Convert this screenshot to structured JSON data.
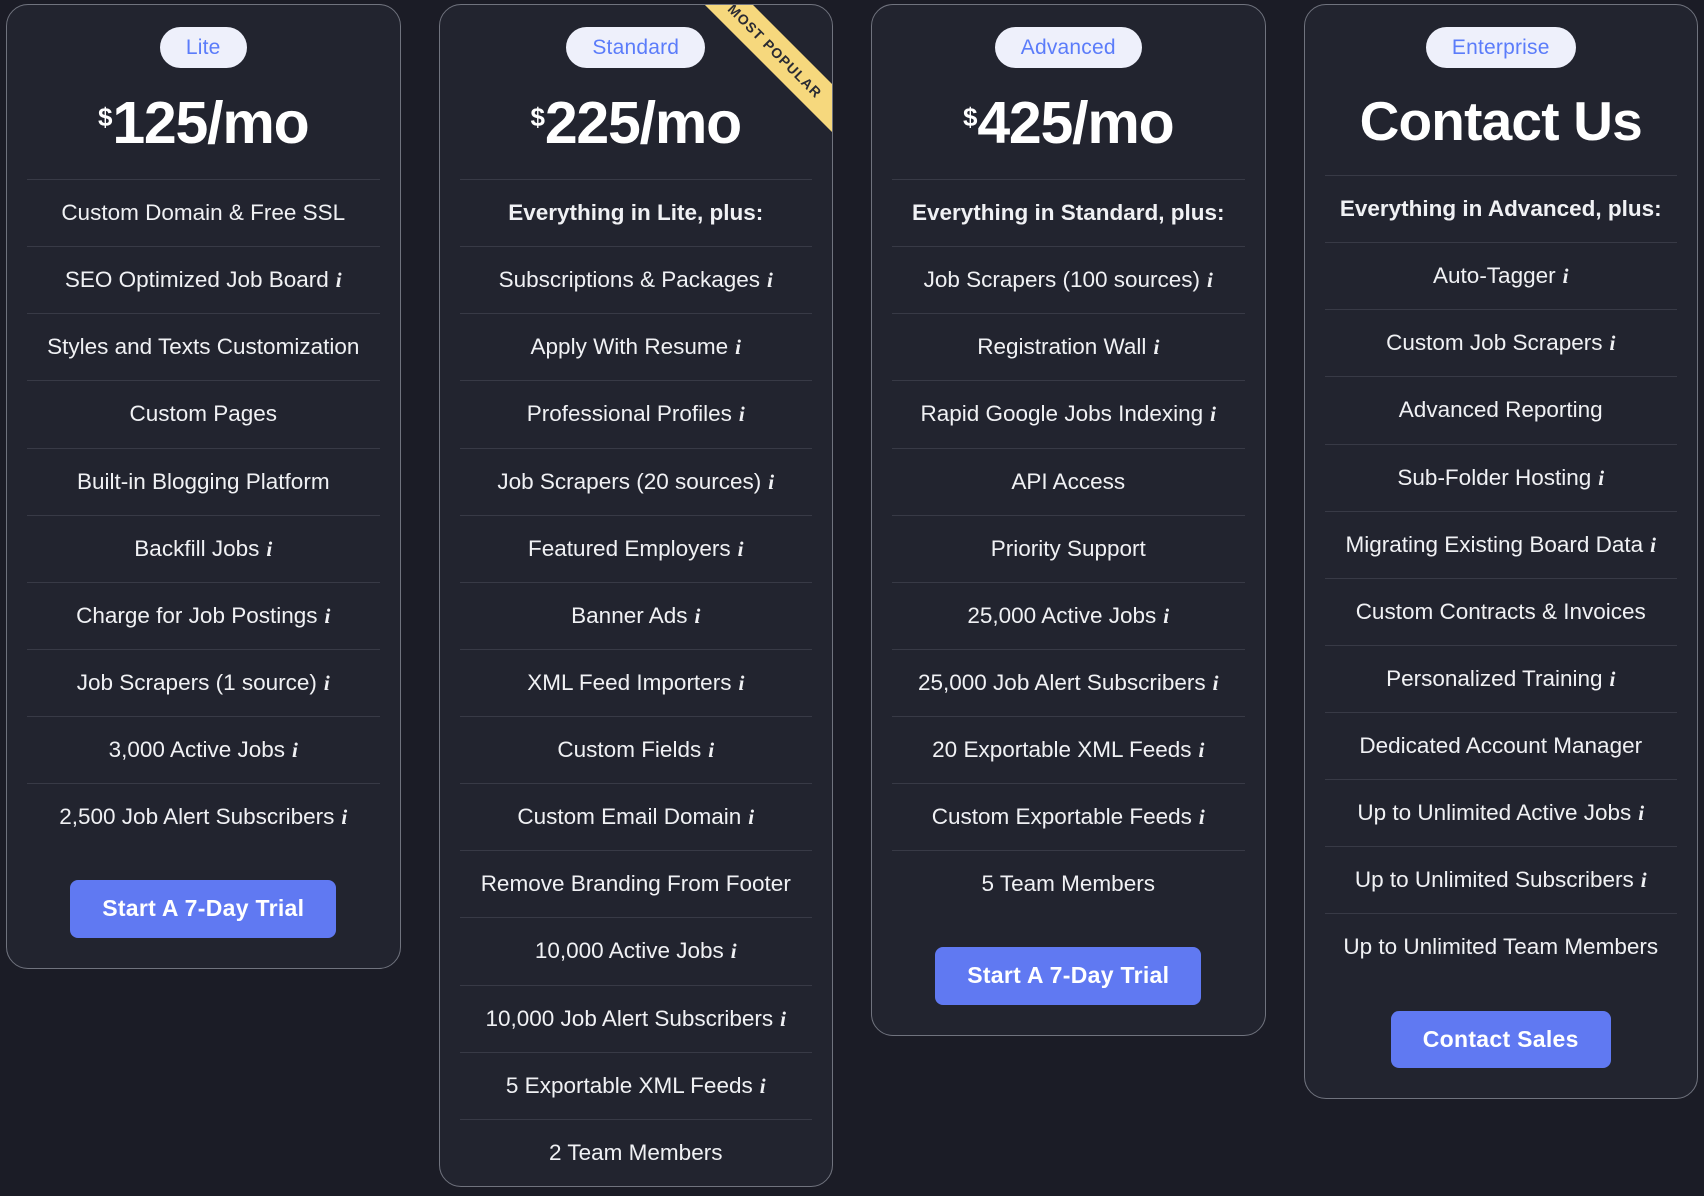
{
  "theme": {
    "page_bg": "#1b1c26",
    "card_bg": "#22242f",
    "card_border": "#70737e",
    "divider": "#383a46",
    "badge_bg": "#eef0fb",
    "badge_text": "#5b7cfa",
    "cta_bg": "#6079f2",
    "cta_text": "#ffffff",
    "ribbon_bg": "#f6d87d",
    "feature_text": "#f0f1f4"
  },
  "icons": {
    "info": "i"
  },
  "plans": [
    {
      "badge": "Lite",
      "currency": "$",
      "price": "125/mo",
      "price_is_text": false,
      "ribbon": null,
      "cta": "Start A 7-Day Trial",
      "features": [
        {
          "label": "Custom Domain & Free SSL",
          "info": false,
          "heading": false
        },
        {
          "label": "SEO Optimized Job Board",
          "info": true,
          "heading": false
        },
        {
          "label": "Styles and Texts Customization",
          "info": false,
          "heading": false
        },
        {
          "label": "Custom Pages",
          "info": false,
          "heading": false
        },
        {
          "label": "Built-in Blogging Platform",
          "info": false,
          "heading": false
        },
        {
          "label": "Backfill Jobs",
          "info": true,
          "heading": false
        },
        {
          "label": "Charge for Job Postings",
          "info": true,
          "heading": false
        },
        {
          "label": "Job Scrapers (1 source)",
          "info": true,
          "heading": false
        },
        {
          "label": "3,000 Active Jobs",
          "info": true,
          "heading": false
        },
        {
          "label": "2,500 Job Alert Subscribers",
          "info": true,
          "heading": false
        }
      ]
    },
    {
      "badge": "Standard",
      "currency": "$",
      "price": "225/mo",
      "price_is_text": false,
      "ribbon": "MOST POPULAR",
      "cta": null,
      "features": [
        {
          "label": "Everything in Lite, plus:",
          "info": false,
          "heading": true
        },
        {
          "label": "Subscriptions & Packages",
          "info": true,
          "heading": false
        },
        {
          "label": "Apply With Resume",
          "info": true,
          "heading": false
        },
        {
          "label": "Professional Profiles",
          "info": true,
          "heading": false
        },
        {
          "label": "Job Scrapers (20 sources)",
          "info": true,
          "heading": false
        },
        {
          "label": "Featured Employers",
          "info": true,
          "heading": false
        },
        {
          "label": "Banner Ads",
          "info": true,
          "heading": false
        },
        {
          "label": "XML Feed Importers",
          "info": true,
          "heading": false
        },
        {
          "label": "Custom Fields",
          "info": true,
          "heading": false
        },
        {
          "label": "Custom Email Domain",
          "info": true,
          "heading": false
        },
        {
          "label": "Remove Branding From Footer",
          "info": false,
          "heading": false
        },
        {
          "label": "10,000 Active Jobs",
          "info": true,
          "heading": false
        },
        {
          "label": "10,000 Job Alert Subscribers",
          "info": true,
          "heading": false
        },
        {
          "label": "5 Exportable XML Feeds",
          "info": true,
          "heading": false
        },
        {
          "label": "2 Team Members",
          "info": false,
          "heading": false
        }
      ]
    },
    {
      "badge": "Advanced",
      "currency": "$",
      "price": "425/mo",
      "price_is_text": false,
      "ribbon": null,
      "cta": "Start A 7-Day Trial",
      "features": [
        {
          "label": "Everything in Standard, plus:",
          "info": false,
          "heading": true
        },
        {
          "label": "Job Scrapers (100 sources)",
          "info": true,
          "heading": false
        },
        {
          "label": "Registration Wall",
          "info": true,
          "heading": false
        },
        {
          "label": "Rapid Google Jobs Indexing",
          "info": true,
          "heading": false
        },
        {
          "label": "API Access",
          "info": false,
          "heading": false
        },
        {
          "label": "Priority Support",
          "info": false,
          "heading": false
        },
        {
          "label": "25,000 Active Jobs",
          "info": true,
          "heading": false
        },
        {
          "label": "25,000 Job Alert Subscribers",
          "info": true,
          "heading": false
        },
        {
          "label": "20 Exportable XML Feeds",
          "info": true,
          "heading": false
        },
        {
          "label": "Custom Exportable Feeds",
          "info": true,
          "heading": false
        },
        {
          "label": "5 Team Members",
          "info": false,
          "heading": false
        }
      ]
    },
    {
      "badge": "Enterprise",
      "currency": "",
      "price": "Contact Us",
      "price_is_text": true,
      "ribbon": null,
      "cta": "Contact Sales",
      "features": [
        {
          "label": "Everything in Advanced, plus:",
          "info": false,
          "heading": true
        },
        {
          "label": "Auto-Tagger",
          "info": true,
          "heading": false
        },
        {
          "label": "Custom Job Scrapers",
          "info": true,
          "heading": false
        },
        {
          "label": "Advanced Reporting",
          "info": false,
          "heading": false
        },
        {
          "label": "Sub-Folder Hosting",
          "info": true,
          "heading": false
        },
        {
          "label": "Migrating Existing Board Data",
          "info": true,
          "heading": false
        },
        {
          "label": "Custom Contracts & Invoices",
          "info": false,
          "heading": false
        },
        {
          "label": "Personalized Training",
          "info": true,
          "heading": false
        },
        {
          "label": "Dedicated Account Manager",
          "info": false,
          "heading": false
        },
        {
          "label": "Up to Unlimited Active Jobs",
          "info": true,
          "heading": false
        },
        {
          "label": "Up to Unlimited Subscribers",
          "info": true,
          "heading": false
        },
        {
          "label": "Up to Unlimited Team Members",
          "info": false,
          "heading": false
        }
      ]
    }
  ]
}
